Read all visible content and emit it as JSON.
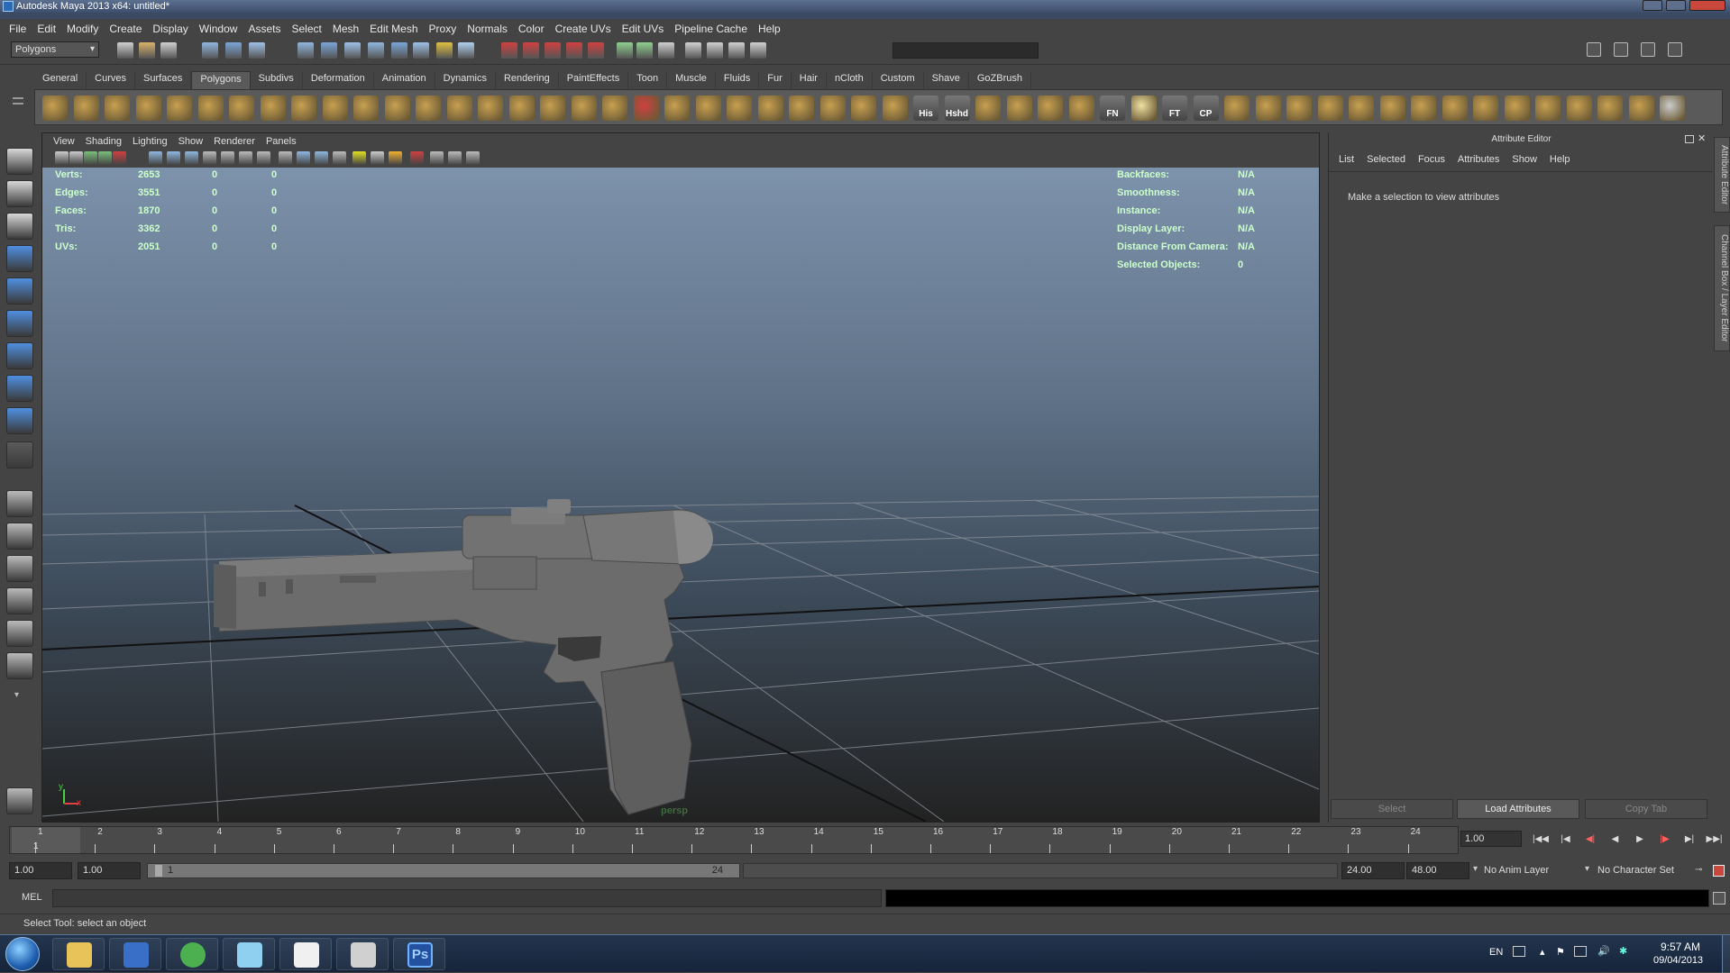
{
  "window": {
    "title": "Autodesk Maya 2013 x64: untitled*"
  },
  "menus": [
    "File",
    "Edit",
    "Modify",
    "Create",
    "Display",
    "Window",
    "Assets",
    "Select",
    "Mesh",
    "Edit Mesh",
    "Proxy",
    "Normals",
    "Color",
    "Create UVs",
    "Edit UVs",
    "Pipeline Cache",
    "Help"
  ],
  "mode_selector": {
    "value": "Polygons"
  },
  "shelf_tabs": [
    "General",
    "Curves",
    "Surfaces",
    "Polygons",
    "Subdivs",
    "Deformation",
    "Animation",
    "Dynamics",
    "Rendering",
    "PaintEffects",
    "Toon",
    "Muscle",
    "Fluids",
    "Fur",
    "Hair",
    "nCloth",
    "Custom",
    "Shave",
    "GoZBrush"
  ],
  "shelf_active": "Polygons",
  "shelf_labels": {
    "his": "His",
    "hshd": "Hshd",
    "fn": "FN",
    "ft": "FT",
    "cp": "CP"
  },
  "viewport": {
    "menu": [
      "View",
      "Shading",
      "Lighting",
      "Show",
      "Renderer",
      "Panels"
    ],
    "camera": "persp",
    "axis_y": "y",
    "axis_x": "x",
    "hud_left": [
      {
        "label": "Verts:",
        "v1": "2653",
        "v2": "0",
        "v3": "0"
      },
      {
        "label": "Edges:",
        "v1": "3551",
        "v2": "0",
        "v3": "0"
      },
      {
        "label": "Faces:",
        "v1": "1870",
        "v2": "0",
        "v3": "0"
      },
      {
        "label": "Tris:",
        "v1": "3362",
        "v2": "0",
        "v3": "0"
      },
      {
        "label": "UVs:",
        "v1": "2051",
        "v2": "0",
        "v3": "0"
      }
    ],
    "hud_right": [
      {
        "label": "Backfaces:",
        "value": "N/A"
      },
      {
        "label": "Smoothness:",
        "value": "N/A"
      },
      {
        "label": "Instance:",
        "value": "N/A"
      },
      {
        "label": "Display Layer:",
        "value": "N/A"
      },
      {
        "label": "Distance From Camera:",
        "value": "N/A"
      },
      {
        "label": "Selected Objects:",
        "value": "0"
      }
    ]
  },
  "attribute_editor": {
    "title": "Attribute Editor",
    "menu": [
      "List",
      "Selected",
      "Focus",
      "Attributes",
      "Show",
      "Help"
    ],
    "message": "Make a selection to view attributes",
    "buttons": {
      "select": "Select",
      "load": "Load Attributes",
      "copy": "Copy Tab"
    },
    "side_tabs": {
      "attr": "Attribute Editor",
      "channel": "Channel Box / Layer Editor"
    }
  },
  "timeline": {
    "ticks": [
      "1",
      "2",
      "3",
      "4",
      "5",
      "6",
      "7",
      "8",
      "9",
      "10",
      "11",
      "12",
      "13",
      "14",
      "15",
      "16",
      "17",
      "18",
      "19",
      "20",
      "21",
      "22",
      "23",
      "24"
    ],
    "current_marker": "1",
    "current_frame": "1.00",
    "playback_icons": [
      "|◀◀",
      "|◀",
      "◀|",
      "◀",
      "▶",
      "|▶",
      "▶|",
      "▶▶|"
    ]
  },
  "range": {
    "start": "1.00",
    "playback_start": "1.00",
    "slider_start": "1",
    "slider_end": "24",
    "playback_end": "24.00",
    "end": "48.00",
    "anim_layer": "No Anim Layer",
    "character_set": "No Character Set"
  },
  "command_line": {
    "label": "MEL"
  },
  "status": {
    "help_line": "Select Tool: select an object"
  },
  "taskbar": {
    "lang": "EN",
    "time": "9:57 AM",
    "date": "09/04/2013",
    "apps": [
      "start-orb",
      "explorer",
      "winrar",
      "chrome",
      "messenger",
      "paint",
      "pen-tool",
      "photoshop"
    ],
    "photoshop_label": "Ps"
  }
}
